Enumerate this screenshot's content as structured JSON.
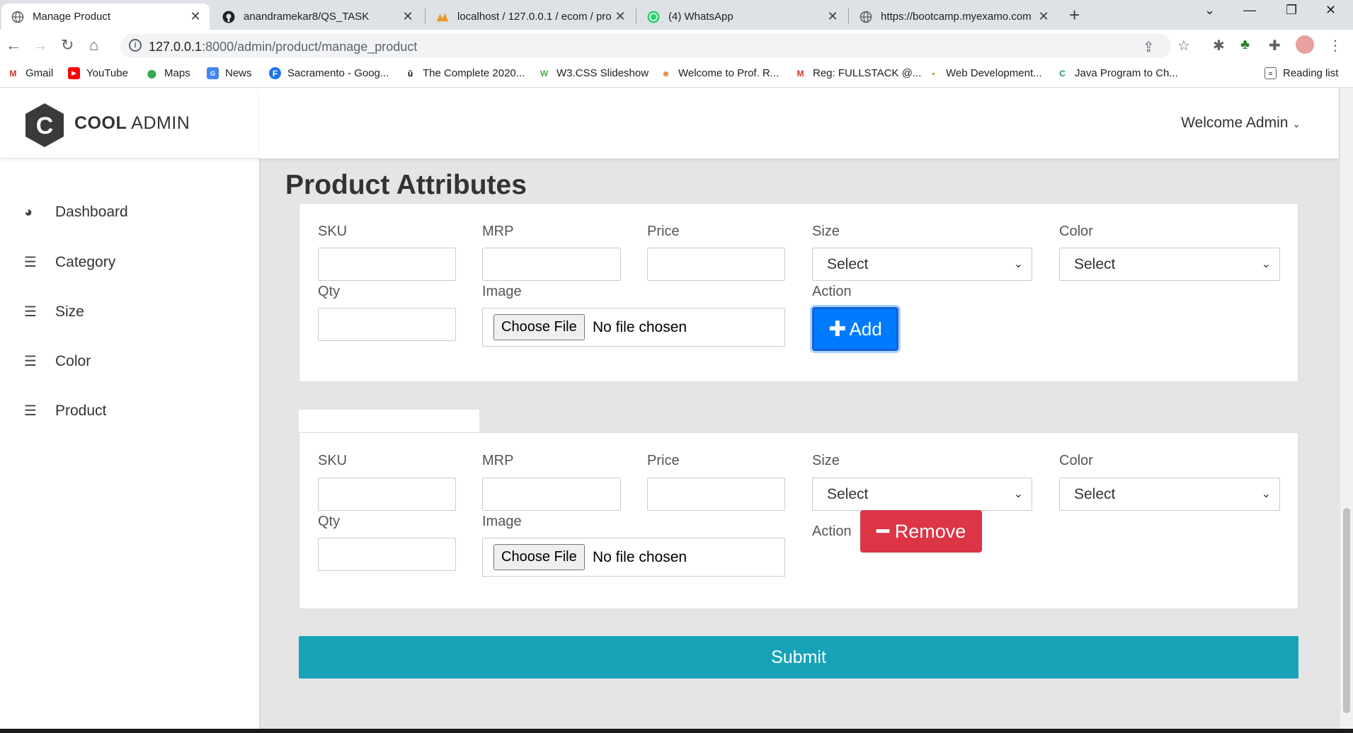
{
  "browser": {
    "tabs": [
      {
        "title": "Manage Product",
        "active": true
      },
      {
        "title": "anandramekar8/QS_TASK",
        "active": false
      },
      {
        "title": "localhost / 127.0.0.1 / ecom / pro",
        "active": false
      },
      {
        "title": "(4) WhatsApp",
        "active": false
      },
      {
        "title": "https://bootcamp.myexamo.com",
        "active": false
      }
    ],
    "url_host": "127.0.0.1",
    "url_rest": ":8000/admin/product/manage_product",
    "bookmarks": [
      {
        "label": "Gmail",
        "icon": "gmail-icon"
      },
      {
        "label": "YouTube",
        "icon": "youtube-icon"
      },
      {
        "label": "Maps",
        "icon": "maps-icon"
      },
      {
        "label": "News",
        "icon": "news-icon"
      },
      {
        "label": "Sacramento - Goog...",
        "icon": "f-icon"
      },
      {
        "label": "The Complete 2020...",
        "icon": "udemy-icon"
      },
      {
        "label": "W3.CSS Slideshow",
        "icon": "w3-icon"
      },
      {
        "label": "Welcome to Prof. R...",
        "icon": "profile-icon"
      },
      {
        "label": "Reg: FULLSTACK @...",
        "icon": "gmail-icon"
      },
      {
        "label": "Web Development...",
        "icon": "bookmark-icon"
      },
      {
        "label": "Java Program to Ch...",
        "icon": "java-icon"
      }
    ],
    "reading_list": "Reading list"
  },
  "sidebar": {
    "logo_letter": "C",
    "brand_bold": "COOL",
    "brand_light": "ADMIN",
    "items": [
      {
        "label": "Dashboard",
        "icon": "dashboard-icon"
      },
      {
        "label": "Category",
        "icon": "list-icon"
      },
      {
        "label": "Size",
        "icon": "list-icon"
      },
      {
        "label": "Color",
        "icon": "list-icon"
      },
      {
        "label": "Product",
        "icon": "list-icon"
      }
    ]
  },
  "header": {
    "welcome": "Welcome Admin"
  },
  "main": {
    "title": "Product Attributes",
    "labels": {
      "sku": "SKU",
      "mrp": "MRP",
      "price": "Price",
      "size": "Size",
      "color": "Color",
      "qty": "Qty",
      "image": "Image",
      "action": "Action"
    },
    "select_default": "Select",
    "choose_file": "Choose File",
    "no_file": "No file chosen",
    "add_label": "Add",
    "remove_label": "Remove",
    "submit_label": "Submit"
  },
  "colors": {
    "add": "#007bff",
    "remove": "#dc3545",
    "submit": "#17a2b8"
  }
}
